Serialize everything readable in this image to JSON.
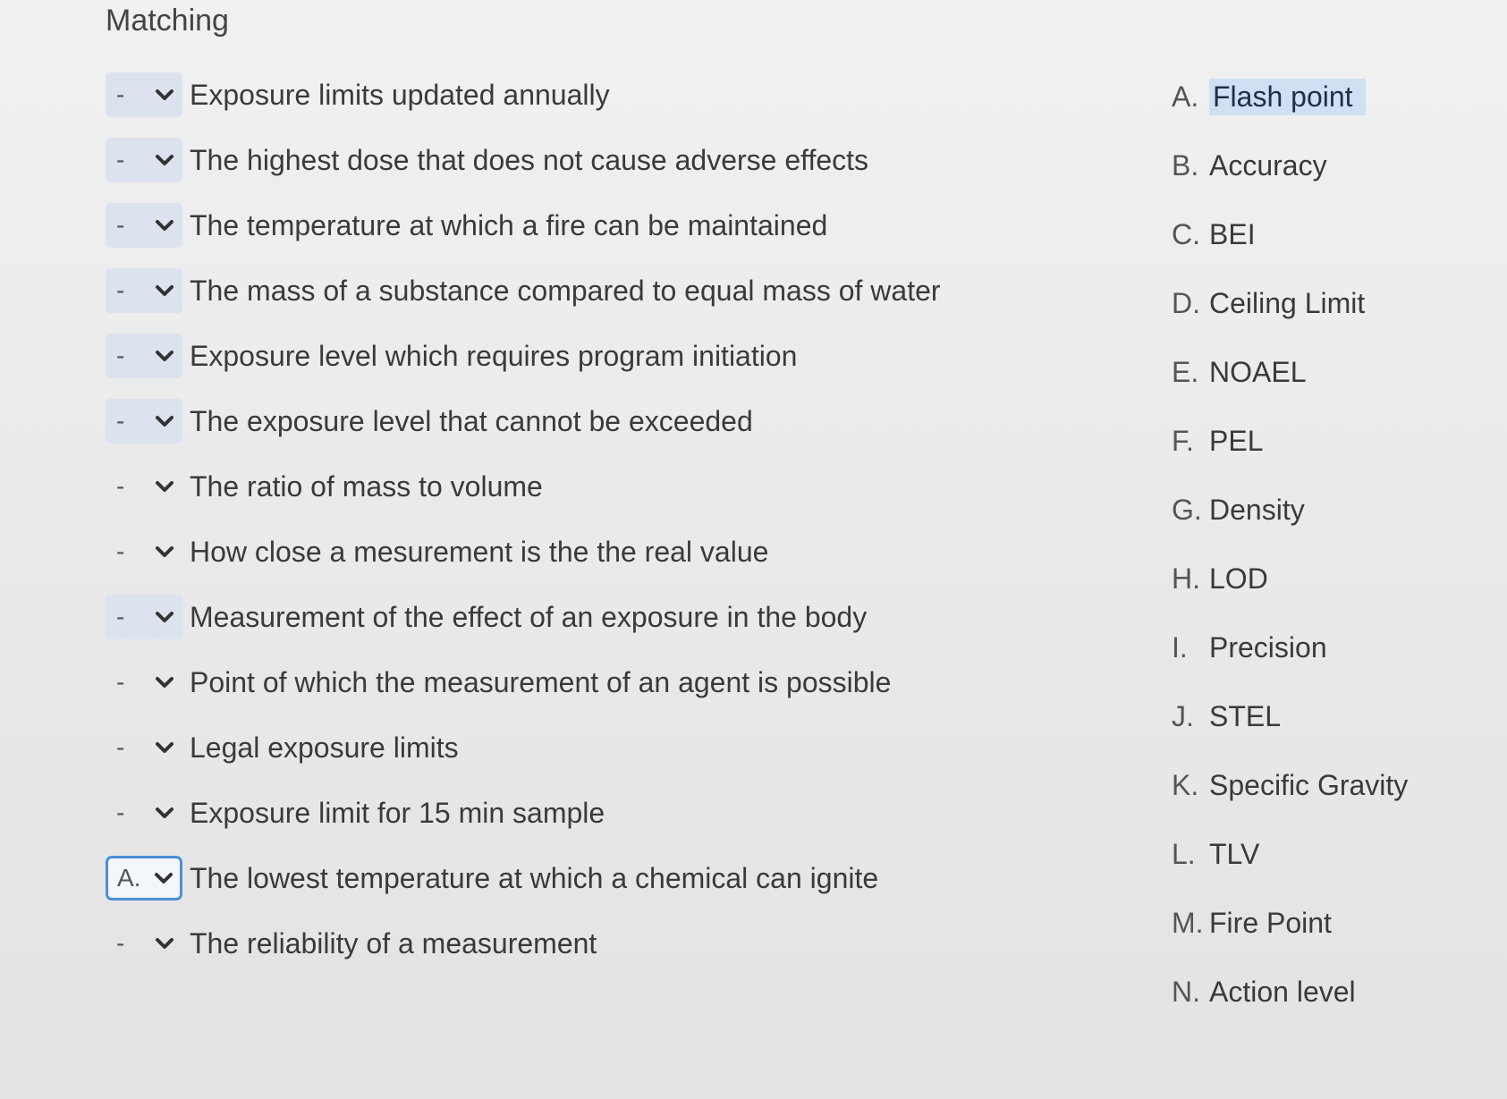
{
  "title": "Matching",
  "questions": [
    {
      "value": "-",
      "text": "Exposure limits updated annually"
    },
    {
      "value": "-",
      "text": "The highest dose that does not cause adverse effects"
    },
    {
      "value": "-",
      "text": "The temperature at which a fire can be maintained"
    },
    {
      "value": "-",
      "text": "The mass of a substance compared to equal mass of water"
    },
    {
      "value": "-",
      "text": "Exposure level which requires program initiation"
    },
    {
      "value": "-",
      "text": "The exposure level that cannot be exceeded"
    },
    {
      "value": "-",
      "text": "The ratio of mass to volume"
    },
    {
      "value": "-",
      "text": "How close a mesurement is the the real value"
    },
    {
      "value": "-",
      "text": "Measurement of the effect of an exposure in the body"
    },
    {
      "value": "-",
      "text": "Point of which the measurement of an agent is possible"
    },
    {
      "value": "-",
      "text": "Legal exposure limits"
    },
    {
      "value": "-",
      "text": "Exposure limit  for 15 min sample"
    },
    {
      "value": "A.",
      "text": "The lowest temperature at which a chemical can ignite"
    },
    {
      "value": "-",
      "text": "The reliability of a measurement"
    }
  ],
  "answers": [
    {
      "letter": "A.",
      "text": "Flash point"
    },
    {
      "letter": "B.",
      "text": "Accuracy"
    },
    {
      "letter": "C.",
      "text": "BEI"
    },
    {
      "letter": "D.",
      "text": "Ceiling Limit"
    },
    {
      "letter": "E.",
      "text": "NOAEL"
    },
    {
      "letter": "F.",
      "text": "PEL"
    },
    {
      "letter": "G.",
      "text": "Density"
    },
    {
      "letter": "H.",
      "text": "LOD"
    },
    {
      "letter": "I.",
      "text": "Precision"
    },
    {
      "letter": "J.",
      "text": "STEL"
    },
    {
      "letter": "K.",
      "text": "Specific Gravity"
    },
    {
      "letter": "L.",
      "text": "TLV"
    },
    {
      "letter": "M.",
      "text": "Fire Point"
    },
    {
      "letter": "N.",
      "text": "Action level"
    }
  ],
  "colors": {
    "focus_border": "#4a90d9",
    "highlight": "#cfe0f2",
    "select_bg": "#dde3ee"
  }
}
